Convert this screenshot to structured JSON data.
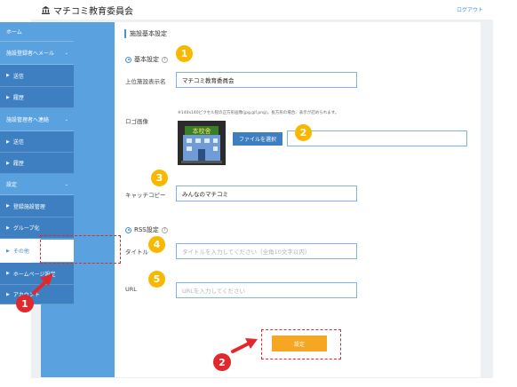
{
  "header": {
    "brand": "マチコミ教育委員会",
    "logout": "ログアウト"
  },
  "sidebar": {
    "items": [
      {
        "label": "ホーム",
        "kind": "section"
      },
      {
        "label": "施設登録者へメール",
        "kind": "section",
        "chevron": "⌄"
      },
      {
        "label": "送信",
        "kind": "sub"
      },
      {
        "label": "履歴",
        "kind": "sub"
      },
      {
        "label": "施設管理者へ連絡",
        "kind": "section",
        "chevron": "⌄"
      },
      {
        "label": "送信",
        "kind": "sub"
      },
      {
        "label": "履歴",
        "kind": "sub"
      },
      {
        "label": "設定",
        "kind": "section",
        "chevron": "⌄"
      },
      {
        "label": "登録施設管理",
        "kind": "sub"
      },
      {
        "label": "グループ化",
        "kind": "sub"
      },
      {
        "label": "その他",
        "kind": "active"
      },
      {
        "label": "ホームページ設定",
        "kind": "sub"
      },
      {
        "label": "アカウント",
        "kind": "sub"
      }
    ]
  },
  "page": {
    "title": "施設基本設定"
  },
  "basic": {
    "heading": "基本設定",
    "name_label": "上位施設表示名",
    "name_value": "マチコミ教育委員会",
    "logo_label": "ロゴ画像",
    "logo_hint": "※140x140ピクセル程の正方形画像(jpg,gif,png)。長方形の場合、表示が詰められます。",
    "logo_icon": "school-building-icon",
    "logo_text": "本校舎",
    "file_button": "ファイルを選択",
    "copy_label": "キャッチコピー",
    "copy_value": "みんなのマチコミ"
  },
  "rss": {
    "heading": "RSS設定",
    "title_label": "タイトル",
    "title_placeholder": "タイトルを入力してください（全角10文字以内）",
    "url_label": "URL",
    "url_placeholder": "URLを入力してください"
  },
  "submit": {
    "label": "設定"
  },
  "badges": {
    "one": "1",
    "two": "2",
    "three": "3",
    "four": "4",
    "five": "5"
  },
  "colors": {
    "accent": "#4a90d9",
    "sidebar": "#5aa1e0",
    "sidebar_sub": "#3d7fc0",
    "submit": "#f5a623",
    "badge_yellow": "#f9b800",
    "badge_red": "#e0292d"
  }
}
